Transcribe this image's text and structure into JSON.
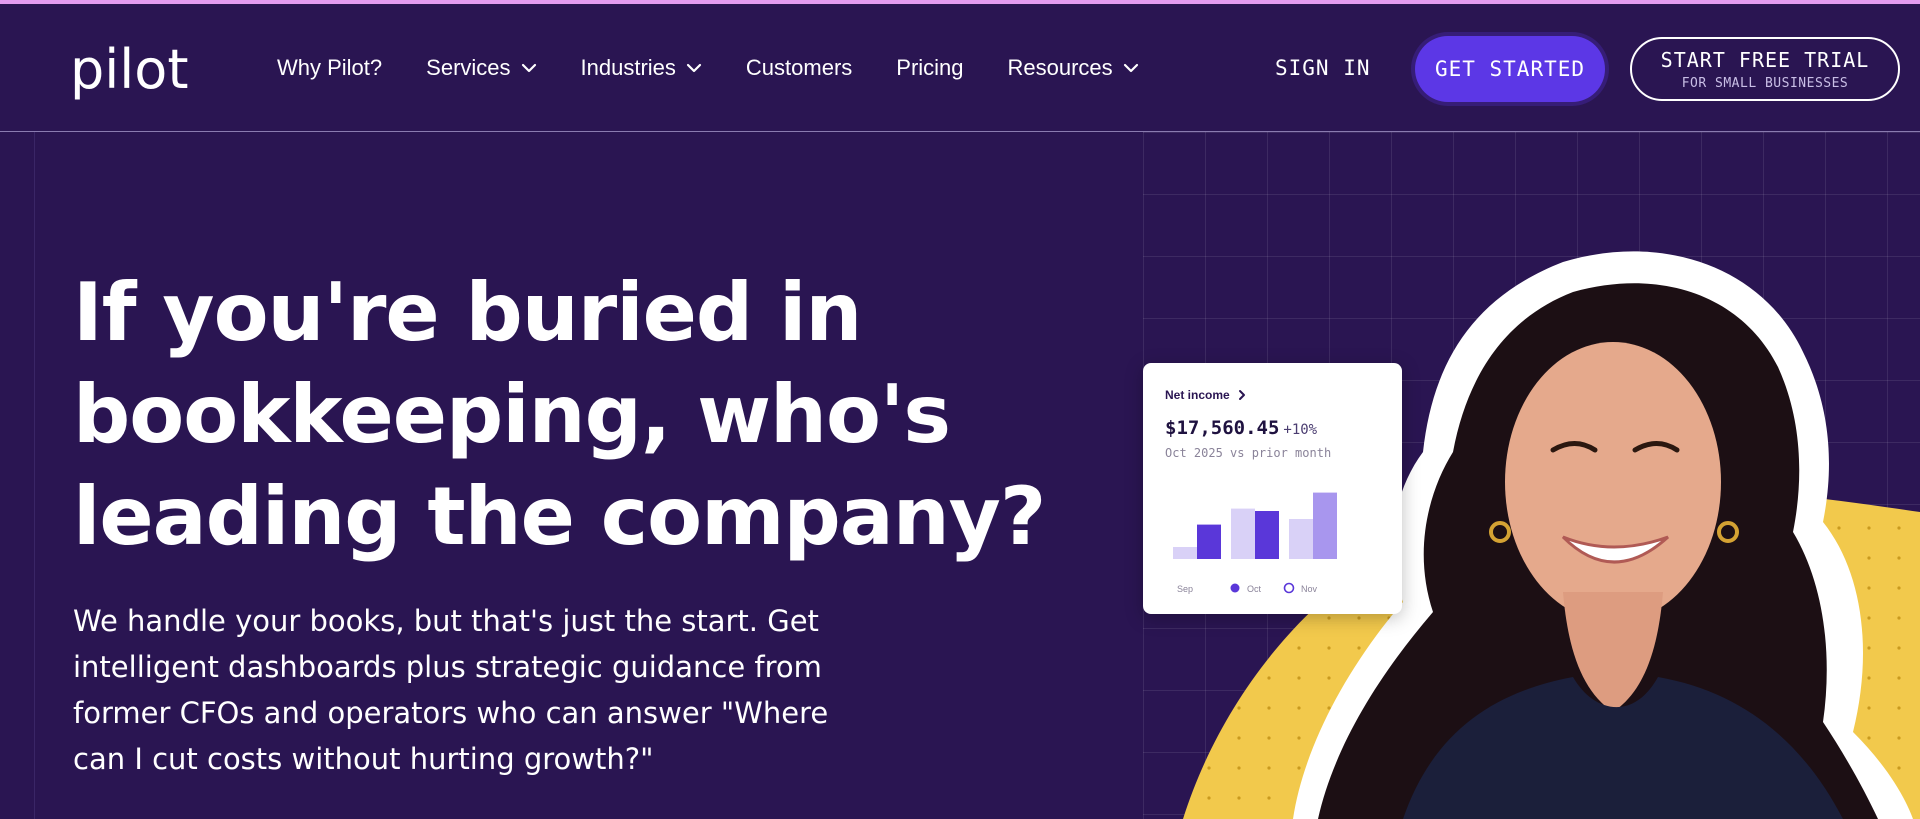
{
  "brand": {
    "logo": "pilot",
    "accent_bar_color": "#e49bf0",
    "background_color": "#2a1552",
    "primary_button_color": "#5c37e6"
  },
  "nav": {
    "items": [
      {
        "label": "Why Pilot?",
        "has_dropdown": false
      },
      {
        "label": "Services",
        "has_dropdown": true
      },
      {
        "label": "Industries",
        "has_dropdown": true
      },
      {
        "label": "Customers",
        "has_dropdown": false
      },
      {
        "label": "Pricing",
        "has_dropdown": false
      },
      {
        "label": "Resources",
        "has_dropdown": true
      }
    ],
    "sign_in": "SIGN IN",
    "get_started": "GET STARTED",
    "trial": {
      "main": "START FREE TRIAL",
      "sub": "FOR SMALL BUSINESSES"
    }
  },
  "hero": {
    "headline": "If you're buried in bookkeeping, who's leading the company?",
    "subcopy": "We handle your books, but that's just the start. Get intelligent dashboards plus strategic guidance from former CFOs and operators who can answer \"Where can I cut costs without hurting growth?\""
  },
  "card": {
    "title": "Net income",
    "value": "$17,560.45",
    "delta": "+10%",
    "period": "Oct 2025 vs prior month",
    "legend": [
      {
        "label": "Sep",
        "marker": "none"
      },
      {
        "label": "Oct",
        "marker": "filled-dot"
      },
      {
        "label": "Nov",
        "marker": "hollow-dot"
      }
    ],
    "bar_colors": {
      "light": "#d9d1f7",
      "dark": "#5a37d9",
      "mid": "#a896ee"
    },
    "bar_levels": [
      0.15,
      0.43,
      0.63,
      0.6,
      0.5,
      0.83
    ]
  },
  "visual": {
    "blob_color": "#f2c94c",
    "outline_color": "#ffffff"
  }
}
